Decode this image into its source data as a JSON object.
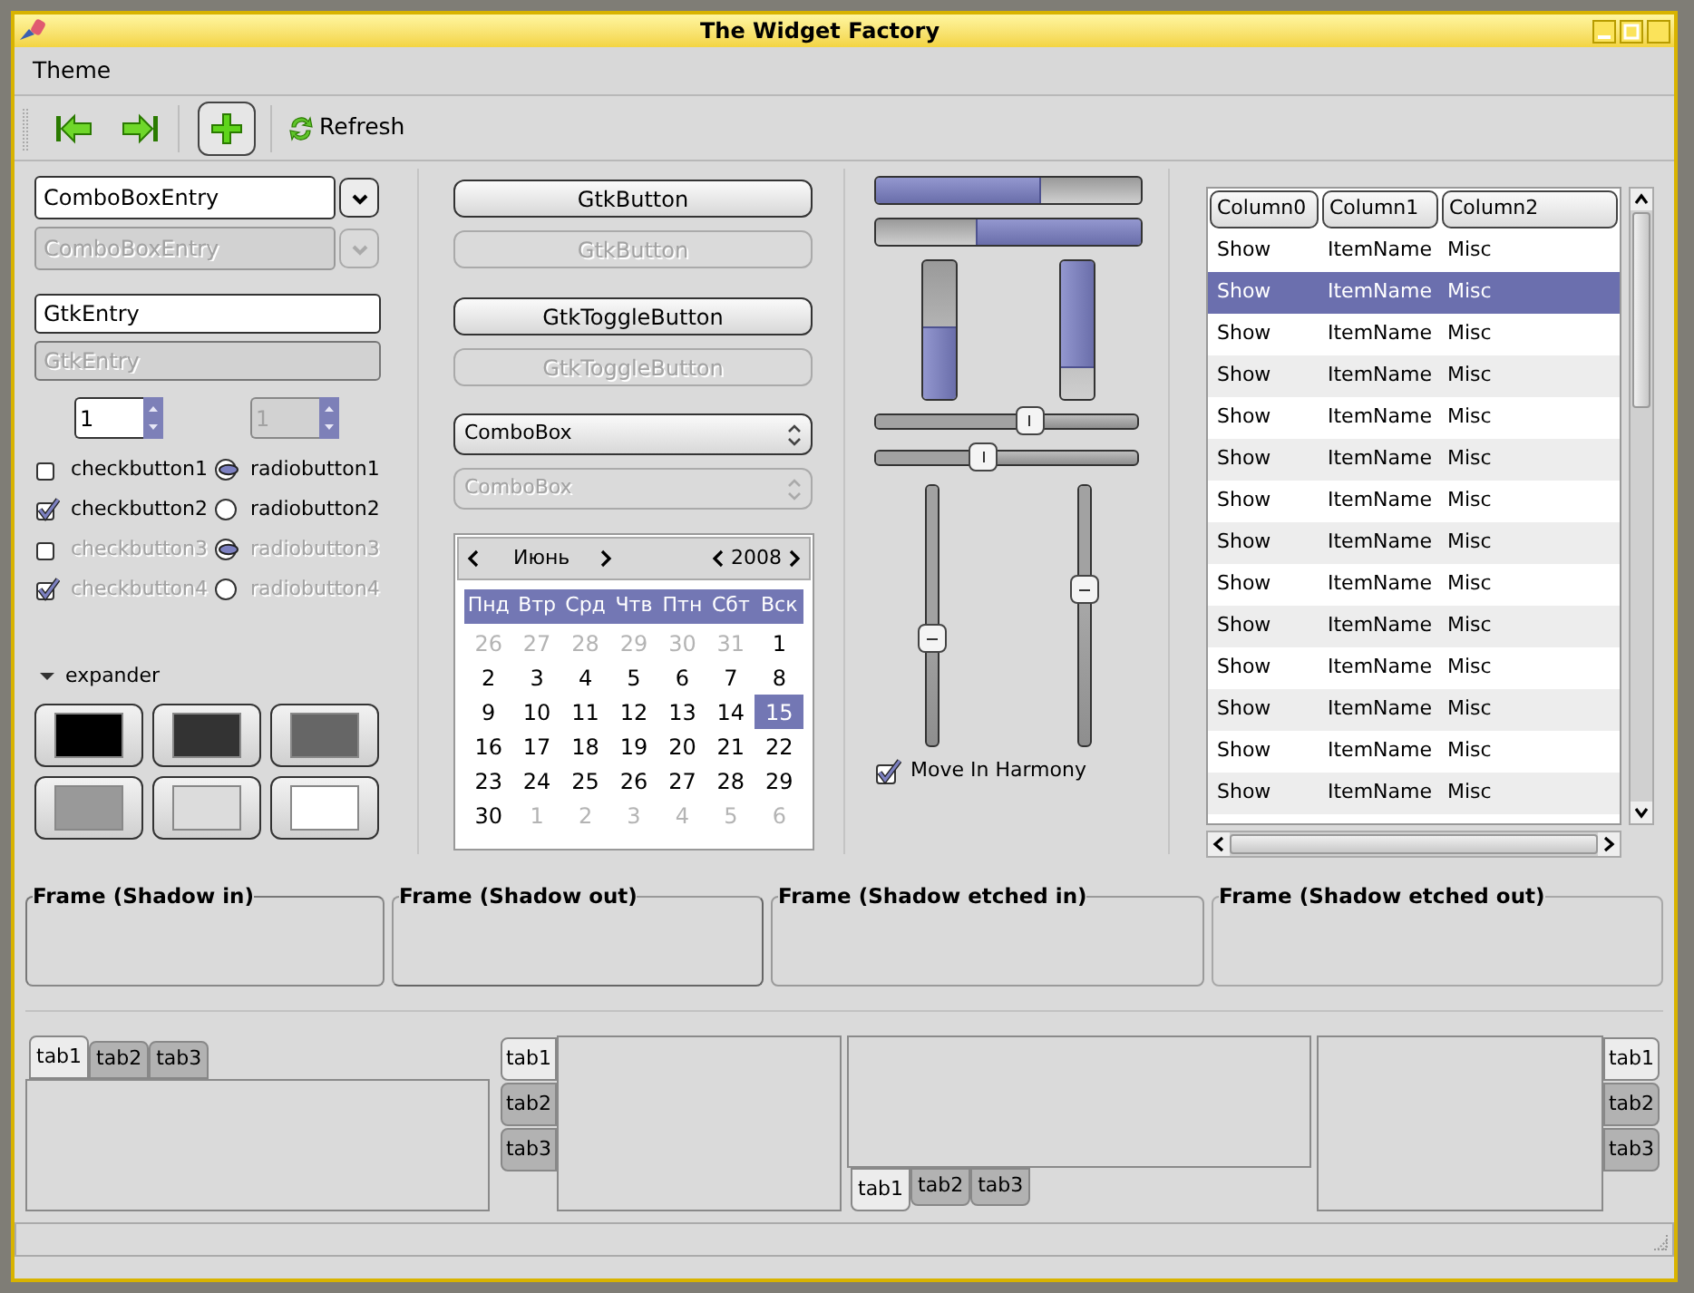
{
  "window": {
    "title": "The Widget Factory"
  },
  "menu": [
    {
      "label": "Theme"
    }
  ],
  "toolbar": {
    "add_toggle": {
      "on": true
    },
    "refresh": {
      "label": "Refresh"
    }
  },
  "combo_entries": [
    {
      "value": "ComboBoxEntry",
      "disabled": false
    },
    {
      "value": "ComboBoxEntry",
      "disabled": true
    }
  ],
  "entries": [
    {
      "value": "GtkEntry",
      "disabled": false
    },
    {
      "value": "GtkEntry",
      "disabled": true
    }
  ],
  "spin_buttons": [
    {
      "value": "1",
      "disabled": false
    },
    {
      "value": "1",
      "disabled": true
    }
  ],
  "check_buttons": [
    {
      "label": "checkbutton1",
      "checked": false,
      "disabled": false
    },
    {
      "label": "checkbutton2",
      "checked": true,
      "disabled": false
    },
    {
      "label": "checkbutton3",
      "checked": false,
      "disabled": true
    },
    {
      "label": "checkbutton4",
      "checked": true,
      "disabled": true
    }
  ],
  "radio_buttons": [
    {
      "label": "radiobutton1",
      "selected": true,
      "disabled": false
    },
    {
      "label": "radiobutton2",
      "selected": false,
      "disabled": false
    },
    {
      "label": "radiobutton3",
      "selected": true,
      "disabled": true
    },
    {
      "label": "radiobutton4",
      "selected": false,
      "disabled": true
    }
  ],
  "expander": {
    "label": "expander",
    "expanded": true
  },
  "color_buttons": [
    {
      "color": "#000000"
    },
    {
      "color": "#333333"
    },
    {
      "color": "#666666"
    },
    {
      "color": "#999999"
    },
    {
      "color": "#dcdcdc"
    },
    {
      "color": "#ffffff"
    }
  ],
  "buttons": [
    {
      "label": "GtkButton",
      "disabled": false
    },
    {
      "label": "GtkButton",
      "disabled": true
    }
  ],
  "toggle_buttons": [
    {
      "label": "GtkToggleButton",
      "disabled": false
    },
    {
      "label": "GtkToggleButton",
      "disabled": true
    }
  ],
  "combo_boxes": [
    {
      "value": "ComboBox",
      "disabled": false
    },
    {
      "value": "ComboBox",
      "disabled": true
    }
  ],
  "calendar": {
    "month": "Июнь",
    "year": "2008",
    "weekdays": [
      "Пнд",
      "Втр",
      "Срд",
      "Чтв",
      "Птн",
      "Сбт",
      "Вск"
    ],
    "days": [
      {
        "label": "26",
        "other_month": true,
        "selected": false
      },
      {
        "label": "27",
        "other_month": true,
        "selected": false
      },
      {
        "label": "28",
        "other_month": true,
        "selected": false
      },
      {
        "label": "29",
        "other_month": true,
        "selected": false
      },
      {
        "label": "30",
        "other_month": true,
        "selected": false
      },
      {
        "label": "31",
        "other_month": true,
        "selected": false
      },
      {
        "label": "1",
        "other_month": false,
        "selected": false
      },
      {
        "label": "2",
        "other_month": false,
        "selected": false
      },
      {
        "label": "3",
        "other_month": false,
        "selected": false
      },
      {
        "label": "4",
        "other_month": false,
        "selected": false
      },
      {
        "label": "5",
        "other_month": false,
        "selected": false
      },
      {
        "label": "6",
        "other_month": false,
        "selected": false
      },
      {
        "label": "7",
        "other_month": false,
        "selected": false
      },
      {
        "label": "8",
        "other_month": false,
        "selected": false
      },
      {
        "label": "9",
        "other_month": false,
        "selected": false
      },
      {
        "label": "10",
        "other_month": false,
        "selected": false
      },
      {
        "label": "11",
        "other_month": false,
        "selected": false
      },
      {
        "label": "12",
        "other_month": false,
        "selected": false
      },
      {
        "label": "13",
        "other_month": false,
        "selected": false
      },
      {
        "label": "14",
        "other_month": false,
        "selected": false
      },
      {
        "label": "15",
        "other_month": false,
        "selected": true
      },
      {
        "label": "16",
        "other_month": false,
        "selected": false
      },
      {
        "label": "17",
        "other_month": false,
        "selected": false
      },
      {
        "label": "18",
        "other_month": false,
        "selected": false
      },
      {
        "label": "19",
        "other_month": false,
        "selected": false
      },
      {
        "label": "20",
        "other_month": false,
        "selected": false
      },
      {
        "label": "21",
        "other_month": false,
        "selected": false
      },
      {
        "label": "22",
        "other_month": false,
        "selected": false
      },
      {
        "label": "23",
        "other_month": false,
        "selected": false
      },
      {
        "label": "24",
        "other_month": false,
        "selected": false
      },
      {
        "label": "25",
        "other_month": false,
        "selected": false
      },
      {
        "label": "26",
        "other_month": false,
        "selected": false
      },
      {
        "label": "27",
        "other_month": false,
        "selected": false
      },
      {
        "label": "28",
        "other_month": false,
        "selected": false
      },
      {
        "label": "29",
        "other_month": false,
        "selected": false
      },
      {
        "label": "30",
        "other_month": false,
        "selected": false
      },
      {
        "label": "1",
        "other_month": true,
        "selected": false
      },
      {
        "label": "2",
        "other_month": true,
        "selected": false
      },
      {
        "label": "3",
        "other_month": true,
        "selected": false
      },
      {
        "label": "4",
        "other_month": true,
        "selected": false
      },
      {
        "label": "5",
        "other_month": true,
        "selected": false
      },
      {
        "label": "6",
        "other_month": true,
        "selected": false
      }
    ]
  },
  "progress_bars": [
    {
      "kind": "horizontal",
      "inverted": false,
      "level": 0.62
    },
    {
      "kind": "horizontal",
      "inverted": true,
      "level": 0.62
    },
    {
      "kind": "vertical",
      "inverted": false,
      "level": 0.52
    },
    {
      "kind": "vertical",
      "inverted": true,
      "level": 0.78
    }
  ],
  "scales": [
    {
      "kind": "horizontal",
      "level": 0.59
    },
    {
      "kind": "horizontal",
      "level": 0.41
    },
    {
      "kind": "vertical",
      "level": 0.59
    },
    {
      "kind": "vertical",
      "level": 0.4
    }
  ],
  "harmony": {
    "label": "Move In Harmony",
    "checked": true
  },
  "tree": {
    "columns": [
      "Column0",
      "Column1",
      "Column2"
    ],
    "rows": [
      {
        "cells": [
          "Show",
          "ItemName",
          "Misc"
        ],
        "selected": false
      },
      {
        "cells": [
          "Show",
          "ItemName",
          "Misc"
        ],
        "selected": true
      },
      {
        "cells": [
          "Show",
          "ItemName",
          "Misc"
        ],
        "selected": false
      },
      {
        "cells": [
          "Show",
          "ItemName",
          "Misc"
        ],
        "selected": false
      },
      {
        "cells": [
          "Show",
          "ItemName",
          "Misc"
        ],
        "selected": false
      },
      {
        "cells": [
          "Show",
          "ItemName",
          "Misc"
        ],
        "selected": false
      },
      {
        "cells": [
          "Show",
          "ItemName",
          "Misc"
        ],
        "selected": false
      },
      {
        "cells": [
          "Show",
          "ItemName",
          "Misc"
        ],
        "selected": false
      },
      {
        "cells": [
          "Show",
          "ItemName",
          "Misc"
        ],
        "selected": false
      },
      {
        "cells": [
          "Show",
          "ItemName",
          "Misc"
        ],
        "selected": false
      },
      {
        "cells": [
          "Show",
          "ItemName",
          "Misc"
        ],
        "selected": false
      },
      {
        "cells": [
          "Show",
          "ItemName",
          "Misc"
        ],
        "selected": false
      },
      {
        "cells": [
          "Show",
          "ItemName",
          "Misc"
        ],
        "selected": false
      },
      {
        "cells": [
          "Show",
          "ItemName",
          "Misc"
        ],
        "selected": false
      }
    ]
  },
  "frames": [
    {
      "label": "Frame (Shadow in)",
      "kind": "in"
    },
    {
      "label": "Frame (Shadow out)",
      "kind": "out"
    },
    {
      "label": "Frame (Shadow etched in)",
      "kind": "etched_in"
    },
    {
      "label": "Frame (Shadow etched out)",
      "kind": "etched_out"
    }
  ],
  "notebooks": [
    {
      "kind": "top",
      "tabs": [
        {
          "label": "tab1",
          "selected": true
        },
        {
          "label": "tab2",
          "selected": false
        },
        {
          "label": "tab3",
          "selected": false
        }
      ]
    },
    {
      "kind": "left",
      "tabs": [
        {
          "label": "tab1",
          "selected": true
        },
        {
          "label": "tab2",
          "selected": false
        },
        {
          "label": "tab3",
          "selected": false
        }
      ]
    },
    {
      "kind": "bottom",
      "tabs": [
        {
          "label": "tab1",
          "selected": true
        },
        {
          "label": "tab2",
          "selected": false
        },
        {
          "label": "tab3",
          "selected": false
        }
      ]
    },
    {
      "kind": "right",
      "tabs": [
        {
          "label": "tab1",
          "selected": true
        },
        {
          "label": "tab2",
          "selected": false
        },
        {
          "label": "tab3",
          "selected": false
        }
      ]
    }
  ]
}
